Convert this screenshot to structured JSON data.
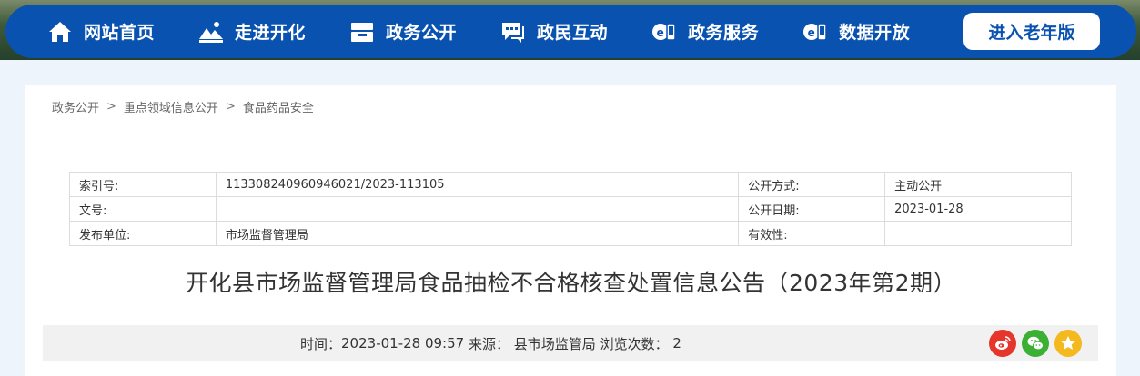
{
  "nav": {
    "items": [
      {
        "label": "网站首页",
        "icon": "home-icon"
      },
      {
        "label": "走进开化",
        "icon": "landscape-icon"
      },
      {
        "label": "政务公开",
        "icon": "inbox-icon"
      },
      {
        "label": "政民互动",
        "icon": "chat-icon"
      },
      {
        "label": "政务服务",
        "icon": "service-icon"
      },
      {
        "label": "数据开放",
        "icon": "data-icon"
      }
    ],
    "elder_button": "进入老年版",
    "colors": {
      "bar": "#0a52b0",
      "button_bg": "#ffffff"
    }
  },
  "breadcrumb": {
    "items": [
      "政务公开",
      "重点领域信息公开",
      "食品药品安全"
    ],
    "separator": ">"
  },
  "meta": {
    "rows": [
      {
        "k1": "索引号:",
        "v1": "113308240960946021/2023-113105",
        "k2": "公开方式:",
        "v2": "主动公开"
      },
      {
        "k1": "文号:",
        "v1": "",
        "k2": "公开日期:",
        "v2": "2023-01-28"
      },
      {
        "k1": "发布单位:",
        "v1": "市场监督管理局",
        "k2": "有效性:",
        "v2": ""
      }
    ]
  },
  "article": {
    "title": "开化县市场监督管理局食品抽检不合格核查处置信息公告（2023年第2期）",
    "time_label": "时间：",
    "time_value": "2023-01-28 09:57",
    "source_label": "来源：",
    "source_value": "县市场监管局",
    "views_label": "浏览次数：",
    "views_value": "2"
  },
  "share": {
    "icons": [
      "weibo-icon",
      "wechat-icon",
      "star-icon"
    ],
    "colors": {
      "weibo": "#e6352b",
      "wechat": "#3cb034",
      "favorite": "#f4b91e"
    }
  }
}
